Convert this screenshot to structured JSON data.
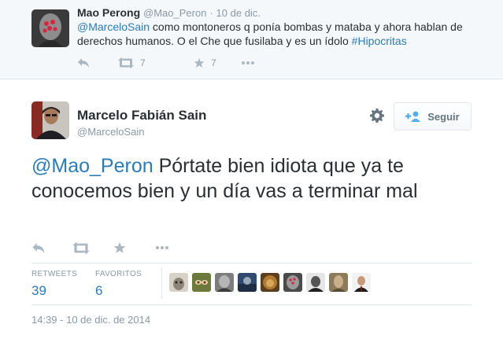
{
  "parent_tweet": {
    "name": "Mao Perong",
    "handle": "@Mao_Peron",
    "separator": "·",
    "time": "10 de dic.",
    "mention": "@MarceloSain",
    "text_line1": " como montoneros q ponía bombas y mataba y ahora hablan de",
    "text_line2": "derechos humanos. O el Che que fusilaba y es un ídolo ",
    "hashtag": "#Hipocritas",
    "retweet_count": "7",
    "favorite_count": "7"
  },
  "main_tweet": {
    "name": "Marcelo Fabián Sain",
    "handle": "@MarceloSain",
    "follow_label": "Seguir",
    "mention": "@Mao_Peron",
    "text_rest": " Pórtate bien idiota que ya te conocemos bien y un día vas a terminar mal",
    "retweets_label": "RETWEETS",
    "retweets_count": "39",
    "favorites_label": "FAVORITOS",
    "favorites_count": "6",
    "timestamp": "14:39 - 10 de dic. de 2014"
  },
  "colors": {
    "link": "#2b7bb9",
    "muted": "#8899a6",
    "icon": "#aab8c2",
    "text": "#292f33",
    "parent_bg": "#f5f8fa"
  },
  "icons": [
    "reply-icon",
    "retweet-icon",
    "favorite-star-icon",
    "more-dots-icon",
    "gear-icon",
    "follow-person-plus-icon"
  ],
  "favoriters": [
    "dog",
    "eyes",
    "grey-face",
    "blue-scene",
    "lion",
    "red-dots-portrait",
    "bw-portrait",
    "old-man",
    "suit-man"
  ]
}
